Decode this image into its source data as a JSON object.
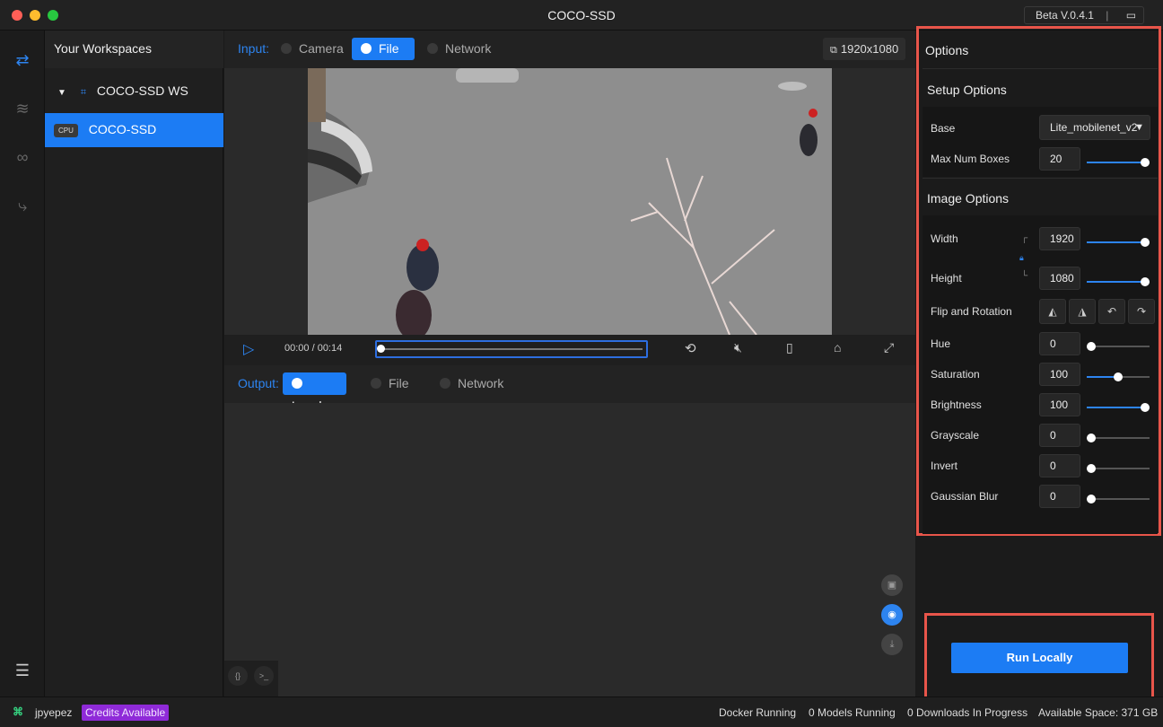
{
  "window": {
    "title": "COCO-SSD",
    "version": "Beta V.0.4.1"
  },
  "sidebar": {
    "heading": "Your Workspaces",
    "workspace": "COCO-SSD WS",
    "model_badge": "CPU",
    "model": "COCO-SSD"
  },
  "input": {
    "label": "Input:",
    "tabs": [
      "Camera",
      "File",
      "Network"
    ],
    "selected": "File",
    "resolution": "1920x1080"
  },
  "player": {
    "time": "00:00 / 00:14",
    "progress": 0
  },
  "output": {
    "label": "Output:",
    "tabs": [
      "Local",
      "File",
      "Network"
    ],
    "selected": "Local"
  },
  "options": {
    "title": "Options",
    "setup_title": "Setup Options",
    "base_label": "Base",
    "base_value": "Lite_mobilenet_v2",
    "max_boxes_label": "Max Num Boxes",
    "max_boxes_value": "20",
    "image_title": "Image Options",
    "width_label": "Width",
    "width_value": "1920",
    "height_label": "Height",
    "height_value": "1080",
    "flip_label": "Flip and Rotation",
    "hue_label": "Hue",
    "hue_value": "0",
    "saturation_label": "Saturation",
    "saturation_value": "100",
    "brightness_label": "Brightness",
    "brightness_value": "100",
    "grayscale_label": "Grayscale",
    "grayscale_value": "0",
    "invert_label": "Invert",
    "invert_value": "0",
    "blur_label": "Gaussian Blur",
    "blur_value": "0",
    "slider_levels": {
      "max_boxes": 1.0,
      "width": 1.0,
      "height": 1.0,
      "hue": 0.0,
      "saturation": 0.5,
      "brightness": 1.0,
      "grayscale": 0.0,
      "invert": 0.0,
      "blur": 0.0
    }
  },
  "run_button": "Run Locally",
  "status": {
    "user": "jpyepez",
    "credits": "Credits Available",
    "docker": "Docker Running",
    "models": "0 Models Running",
    "downloads": "0 Downloads In Progress",
    "space": "Available Space: 371 GB"
  },
  "colors": {
    "accent": "#1c7cf4",
    "highlight": "#e8554a",
    "credits": "#8f2ad8"
  }
}
